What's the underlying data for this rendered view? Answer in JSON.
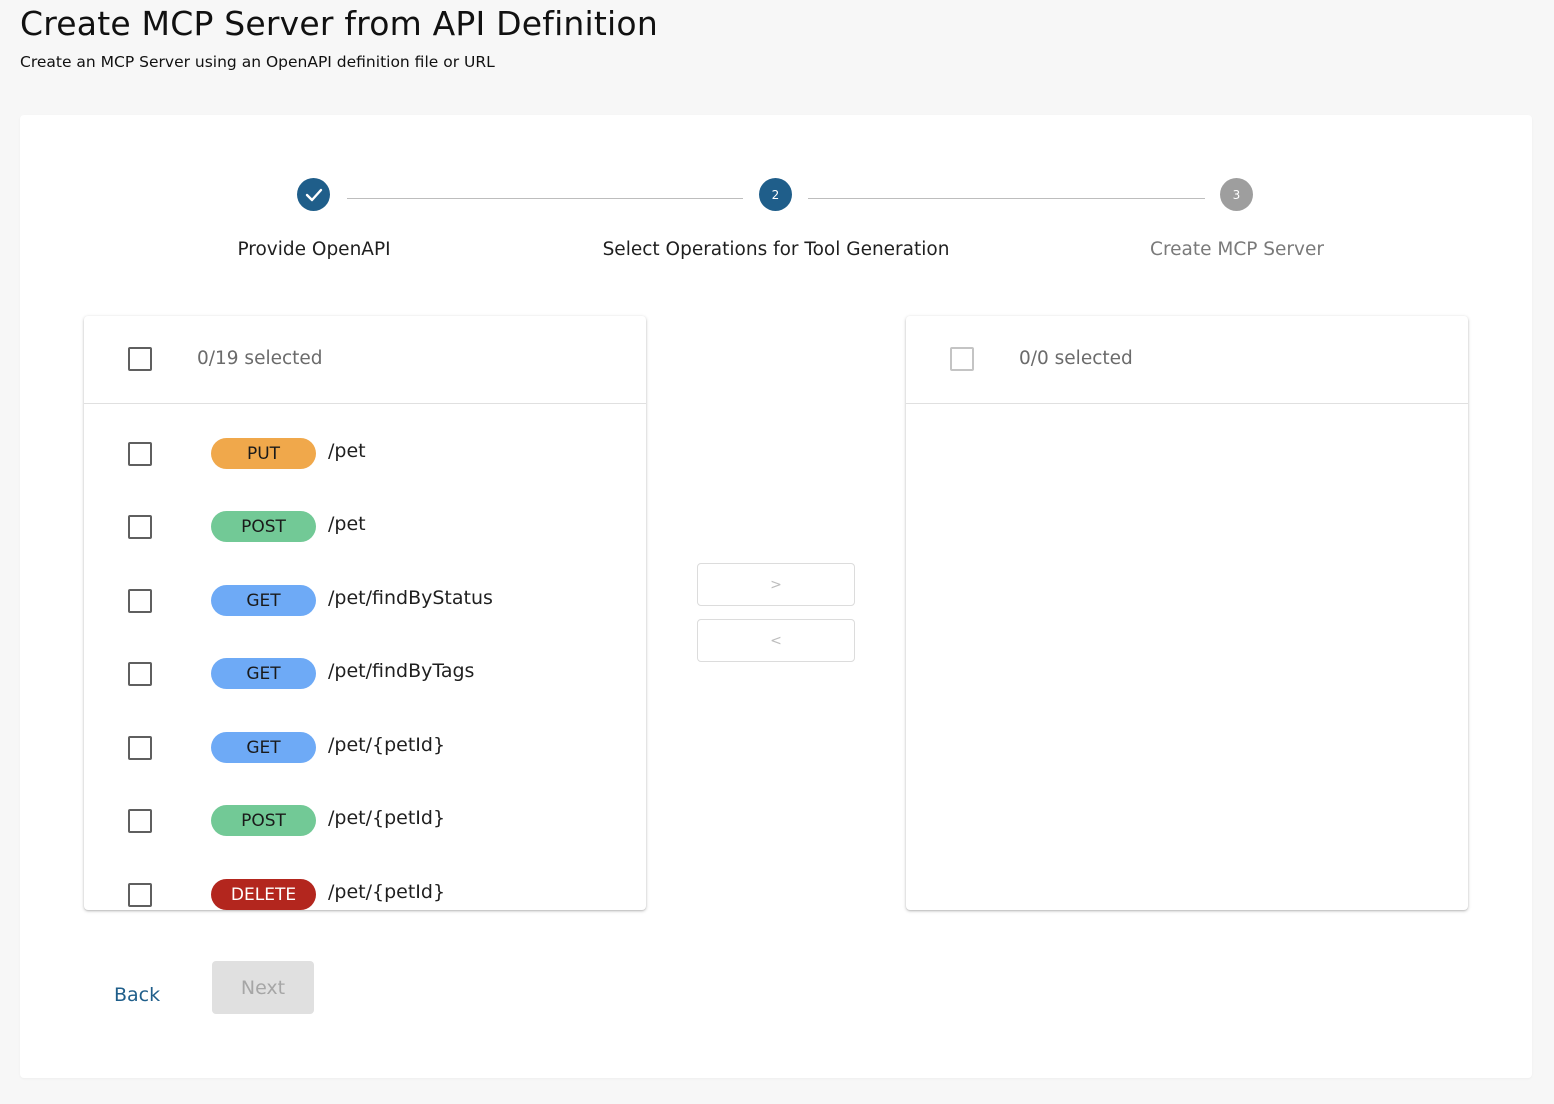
{
  "page": {
    "title": "Create MCP Server from API Definition",
    "subtitle": "Create an MCP Server using an OpenAPI definition file or URL"
  },
  "stepper": {
    "steps": [
      {
        "number": "1",
        "label": "Provide OpenAPI",
        "state": "completed",
        "icon": "check-icon"
      },
      {
        "number": "2",
        "label": "Select Operations for Tool Generation",
        "state": "active"
      },
      {
        "number": "3",
        "label": "Create MCP Server",
        "state": "pending"
      }
    ],
    "colors": {
      "active": "#1f5e8a",
      "pending": "#9e9e9e"
    }
  },
  "left_list": {
    "count_label": "0/19 selected",
    "operations": [
      {
        "method": "PUT",
        "path": "/pet",
        "color": "#f0a84b"
      },
      {
        "method": "POST",
        "path": "/pet",
        "color": "#72c996"
      },
      {
        "method": "GET",
        "path": "/pet/findByStatus",
        "color": "#6eaaf6"
      },
      {
        "method": "GET",
        "path": "/pet/findByTags",
        "color": "#6eaaf6"
      },
      {
        "method": "GET",
        "path": "/pet/{petId}",
        "color": "#6eaaf6"
      },
      {
        "method": "POST",
        "path": "/pet/{petId}",
        "color": "#72c996"
      },
      {
        "method": "DELETE",
        "path": "/pet/{petId}",
        "color": "#b3261e"
      }
    ]
  },
  "right_list": {
    "count_label": "0/0 selected"
  },
  "transfer": {
    "move_right_label": ">",
    "move_left_label": "<"
  },
  "actions": {
    "back_label": "Back",
    "next_label": "Next"
  }
}
